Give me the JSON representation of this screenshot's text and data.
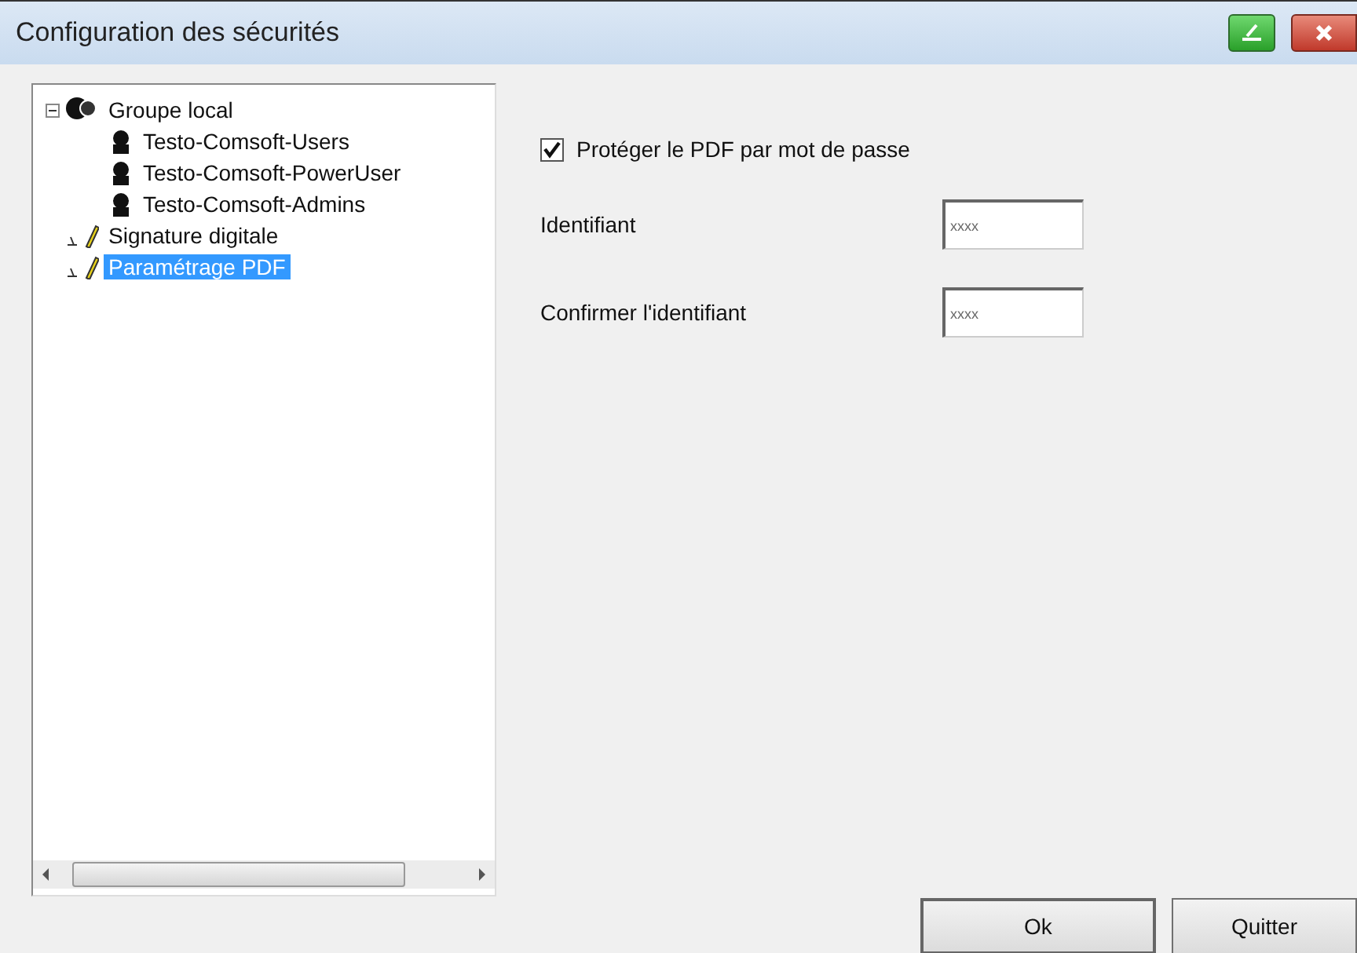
{
  "window": {
    "title": "Configuration des sécurités"
  },
  "tree": [
    {
      "label": "Groupe local",
      "kind": "group",
      "expanded": true,
      "selected": false,
      "children": [
        {
          "label": "Testo-Comsoft-Users",
          "kind": "user",
          "selected": false
        },
        {
          "label": "Testo-Comsoft-PowerUser",
          "kind": "user",
          "selected": false
        },
        {
          "label": "Testo-Comsoft-Admins",
          "kind": "user",
          "selected": false
        }
      ]
    },
    {
      "label": "Signature digitale",
      "kind": "setting",
      "selected": false
    },
    {
      "label": "Paramétrage PDF",
      "kind": "setting",
      "selected": true
    }
  ],
  "protect_checkbox": {
    "label": "Protéger le PDF par mot de passe",
    "checked": true
  },
  "fields": [
    {
      "label": "Identifiant",
      "value": "xxxx"
    },
    {
      "label": "Confirmer l'identifiant",
      "value": "xxxx"
    }
  ],
  "buttons": [
    "Ok",
    "Quitter"
  ]
}
